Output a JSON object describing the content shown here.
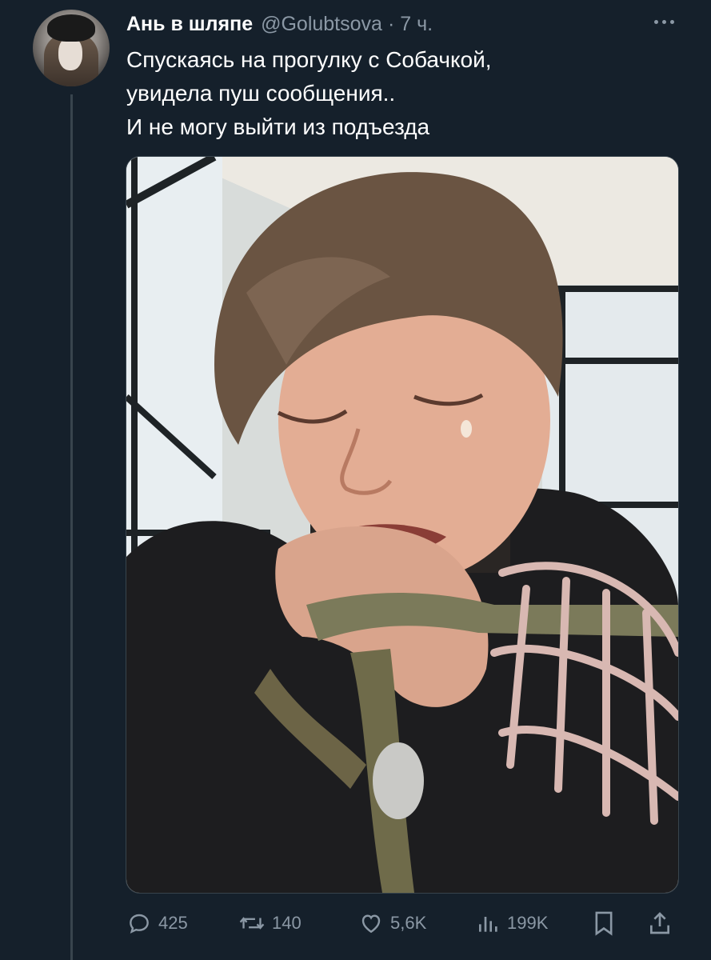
{
  "tweet": {
    "author_name": "Ань в шляпе",
    "handle": "@Golubtsova",
    "separator": "·",
    "time": "7 ч.",
    "text_lines": [
      "Спускаясь на прогулку с Собачкой,",
      "увидела пуш сообщения..",
      "И не могу выйти из подъезда"
    ]
  },
  "icons": {
    "more": "more-icon",
    "reply": "reply-icon",
    "retweet": "retweet-icon",
    "like": "heart-icon",
    "views": "views-icon",
    "bookmark": "bookmark-icon",
    "share": "share-icon"
  },
  "actions": {
    "replies": "425",
    "retweets": "140",
    "likes": "5,6K",
    "views": "199K"
  },
  "colors": {
    "background": "#15202b",
    "muted": "#8b98a5",
    "text": "#ffffff",
    "divider": "#38444d"
  }
}
